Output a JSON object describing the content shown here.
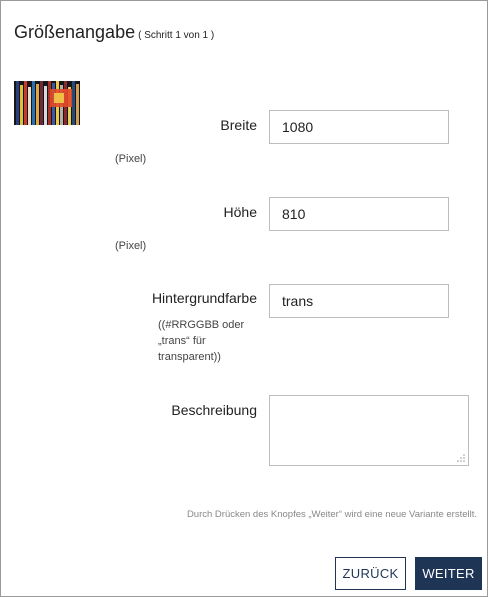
{
  "dialog": {
    "title": "Größenangabe",
    "step": "( Schritt 1 von 1 )"
  },
  "thumbnail": {
    "description_icon": "image-thumbnail"
  },
  "form": {
    "width": {
      "label": "Breite",
      "value": "1080",
      "hint": "(Pixel)"
    },
    "height": {
      "label": "Höhe",
      "value": "810",
      "hint": "(Pixel)"
    },
    "background": {
      "label": "Hintergrundfarbe",
      "value": "trans",
      "hint_line1": "((#RRGGBB oder",
      "hint_line2": "„trans“ für",
      "hint_line3": "transparent))"
    },
    "description": {
      "label": "Beschreibung",
      "value": ""
    }
  },
  "footer": {
    "note": "Durch Drücken des Knopfes „Weiter“ wird eine neue Variante erstellt.",
    "back_label": "ZURÜCK",
    "next_label": "WEITER"
  },
  "colors": {
    "primary": "#1f3556",
    "border": "#bdbdbd"
  }
}
